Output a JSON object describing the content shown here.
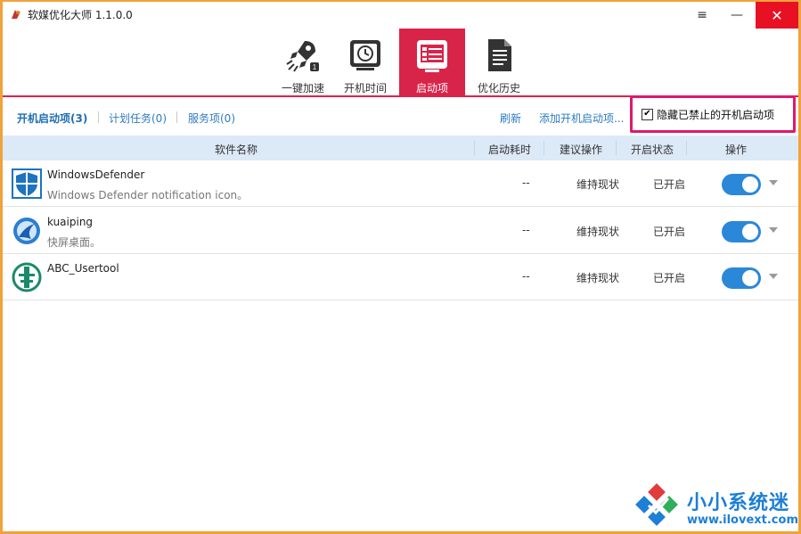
{
  "window": {
    "title": "软媒优化大师 1.1.0.0",
    "menu_glyph": "≡",
    "minimize_glyph": "—",
    "close_glyph": "✕"
  },
  "toolbar": {
    "items": [
      {
        "label": "一键加速",
        "icon": "rocket-icon"
      },
      {
        "label": "开机时间",
        "icon": "clock-icon"
      },
      {
        "label": "启动项",
        "icon": "startup-list-icon",
        "active": true
      },
      {
        "label": "优化历史",
        "icon": "document-icon"
      }
    ]
  },
  "subtabs": {
    "items": [
      "开机启动项(3)",
      "计划任务(0)",
      "服务项(0)"
    ],
    "refresh": "刷新",
    "add": "添加开机启动项...",
    "hide_disabled": {
      "label": "隐藏已禁止的开机启动项",
      "checked": true
    }
  },
  "table": {
    "headers": [
      "软件名称",
      "启动耗时",
      "建议操作",
      "开启状态",
      "操作"
    ],
    "rows": [
      {
        "name": "WindowsDefender",
        "desc": "Windows Defender notification icon。",
        "time": "--",
        "suggest": "维持现状",
        "status": "已开启",
        "enabled": true,
        "icon": "shield-icon"
      },
      {
        "name": "kuaiping",
        "desc": "快屏桌面。",
        "time": "--",
        "suggest": "维持现状",
        "status": "已开启",
        "enabled": true,
        "icon": "kuaiping-logo-icon"
      },
      {
        "name": "ABC_Usertool",
        "desc": "",
        "time": "--",
        "suggest": "维持现状",
        "status": "已开启",
        "enabled": true,
        "icon": "abc-bank-logo-icon"
      }
    ]
  },
  "watermark": {
    "name": "小小系统迷",
    "url": "www.ilovext.com"
  },
  "colors": {
    "accent": "#d9244a",
    "link": "#2d7bc0",
    "toggle": "#2b88d8",
    "header_bg": "#dce9f7",
    "highlight_box": "#e0186e"
  }
}
